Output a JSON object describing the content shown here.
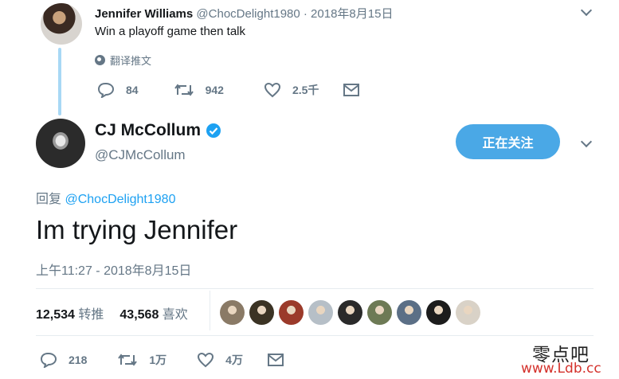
{
  "reply_tweet": {
    "name": "Jennifer Williams",
    "handle_date": "@ChocDelight1980 · 2018年8月15日",
    "text": "Win a playoff game then talk",
    "translate_label": "翻译推文",
    "actions": {
      "replies": "84",
      "retweets": "942",
      "likes": "2.5千"
    }
  },
  "main_tweet": {
    "name": "CJ McCollum",
    "handle": "@CJMcCollum",
    "follow_label": "正在关注",
    "replying_prefix": "回复",
    "replying_to": "@ChocDelight1980",
    "text": "Im trying Jennifer",
    "timestamp": "上午11:27 - 2018年8月15日",
    "stats": {
      "retweets_count": "12,534",
      "retweets_label": "转推",
      "likes_count": "43,568",
      "likes_label": "喜欢"
    },
    "actions": {
      "replies": "218",
      "retweets": "1万",
      "likes": "4万"
    }
  },
  "watermark": {
    "cn": "零点吧",
    "url": "www.Ldb.cc"
  },
  "colors": {
    "accent": "#1da1f2",
    "follow_bg": "#4aa8e6",
    "muted": "#657786",
    "thread": "#a8d8f5"
  },
  "likers": [
    {
      "name": "liker-avatar-1",
      "color": "#8a7a66"
    },
    {
      "name": "liker-avatar-2",
      "color": "#3b3324"
    },
    {
      "name": "liker-avatar-3",
      "color": "#9b3a2a"
    },
    {
      "name": "liker-avatar-4",
      "color": "#b6bfc7"
    },
    {
      "name": "liker-avatar-5",
      "color": "#2a2a2a"
    },
    {
      "name": "liker-avatar-6",
      "color": "#6d7a55"
    },
    {
      "name": "liker-avatar-7",
      "color": "#5b6f86"
    },
    {
      "name": "liker-avatar-8",
      "color": "#1c1c1c"
    },
    {
      "name": "liker-avatar-9",
      "color": "#d9d2c7"
    }
  ]
}
